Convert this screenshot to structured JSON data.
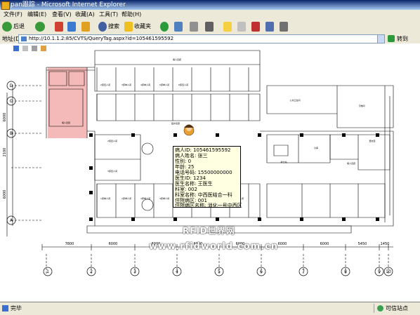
{
  "window": {
    "title": "pan跟踪 - Microsoft Internet Explorer"
  },
  "menu": [
    "文件(F)",
    "编辑(E)",
    "查看(V)",
    "收藏(A)",
    "工具(T)",
    "帮助(H)"
  ],
  "toolbar": {
    "back": "后退",
    "search": "搜索",
    "favorites": "收藏夹"
  },
  "address": {
    "label": "地址(D)",
    "url": "http://10.1.1.2:85/CVTS/QueryTag.aspx?id=105461595592",
    "go": "转到"
  },
  "popup": {
    "lines": [
      "病人ID: 105461595592",
      "病人姓名: 张三",
      "性别: 0",
      "年龄: 25",
      "电话号码: 15500000000",
      "医生ID: 1234",
      "医生名称: 王医生",
      "科室: 002",
      "科室名称: 中西医结合一科",
      "住院病区: 001",
      "住院病区名称: 消化一号中西区"
    ]
  },
  "watermark": {
    "line1": "RFID世界网",
    "line2": "www.rfidworld.com.cn"
  },
  "status": {
    "left": "完毕",
    "zone": "可信站点"
  },
  "colors": {
    "titlebar": "#0a246a",
    "highlight_room": "#f4b9b9",
    "popup_bg": "#ffffe1"
  },
  "floorplan": {
    "row_labels": [
      "D",
      "C",
      "B",
      "A"
    ],
    "col_labels": [
      "1",
      "2",
      "3",
      "4",
      "5",
      "6",
      "7",
      "8",
      "9",
      "10"
    ],
    "dimensions": [
      "7800",
      "6000",
      "6000",
      "6000",
      "6000",
      "6000",
      "6000",
      "6000",
      "5450",
      "1450"
    ],
    "left_dimensions": [
      "6000",
      "2100",
      "6000"
    ],
    "room_labels": [
      "病人走廊",
      "2床四人间",
      "3床单人间",
      "4床单人间",
      "5床单人间",
      "6床四人间",
      "医护走廊",
      "病人走廊",
      "2床四人间",
      "3床四人间",
      "1床单人间",
      "2床单人间",
      "3床单人间",
      "4床单人间",
      "5床单人间",
      "6床四人间",
      "公共卫生间",
      "病人走廊",
      "污物间",
      "冷库",
      "护士站",
      "更衣室"
    ]
  }
}
